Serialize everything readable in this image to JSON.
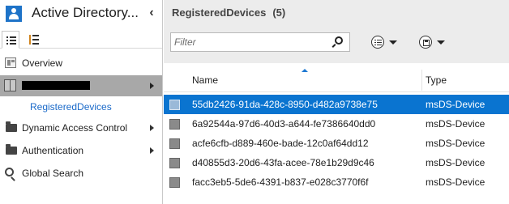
{
  "nav": {
    "title": "Active Directory...",
    "collapse_glyph": "‹",
    "view_tabs": [
      {
        "icon": "list-view-icon"
      },
      {
        "icon": "tree-view-icon"
      }
    ],
    "items": [
      {
        "label": "Overview",
        "icon": "overview-icon"
      },
      {
        "label": "",
        "icon": "domain-icon",
        "redacted": true
      },
      {
        "label": "RegisteredDevices",
        "icon": "",
        "sub": true
      },
      {
        "label": "Dynamic Access Control",
        "icon": "folder-icon"
      },
      {
        "label": "Authentication",
        "icon": "folder-icon"
      },
      {
        "label": "Global Search",
        "icon": "search-icon"
      }
    ]
  },
  "content": {
    "title": "RegisteredDevices",
    "count": "(5)",
    "filter": {
      "placeholder": "Filter",
      "value": ""
    },
    "columns": {
      "name": "Name",
      "type": "Type"
    },
    "rows": [
      {
        "name": "55db2426-91da-428c-8950-d482a9738e75",
        "type": "msDS-Device",
        "selected": true
      },
      {
        "name": "6a92544a-97d6-40d3-a644-fe7386640dd0",
        "type": "msDS-Device",
        "selected": false
      },
      {
        "name": "acfe6cfb-d889-460e-bade-12c0af64dd12",
        "type": "msDS-Device",
        "selected": false
      },
      {
        "name": "d40855d3-20d6-43fa-acee-78e1b29d9c46",
        "type": "msDS-Device",
        "selected": false
      },
      {
        "name": "facc3eb5-5de6-4391-b837-e028c3770f6f",
        "type": "msDS-Device",
        "selected": false
      }
    ]
  },
  "colors": {
    "selection": "#0a74d0",
    "nav_selected": "#a8a8a8",
    "link": "#1b6ac9",
    "app_icon": "#1e73c8"
  }
}
